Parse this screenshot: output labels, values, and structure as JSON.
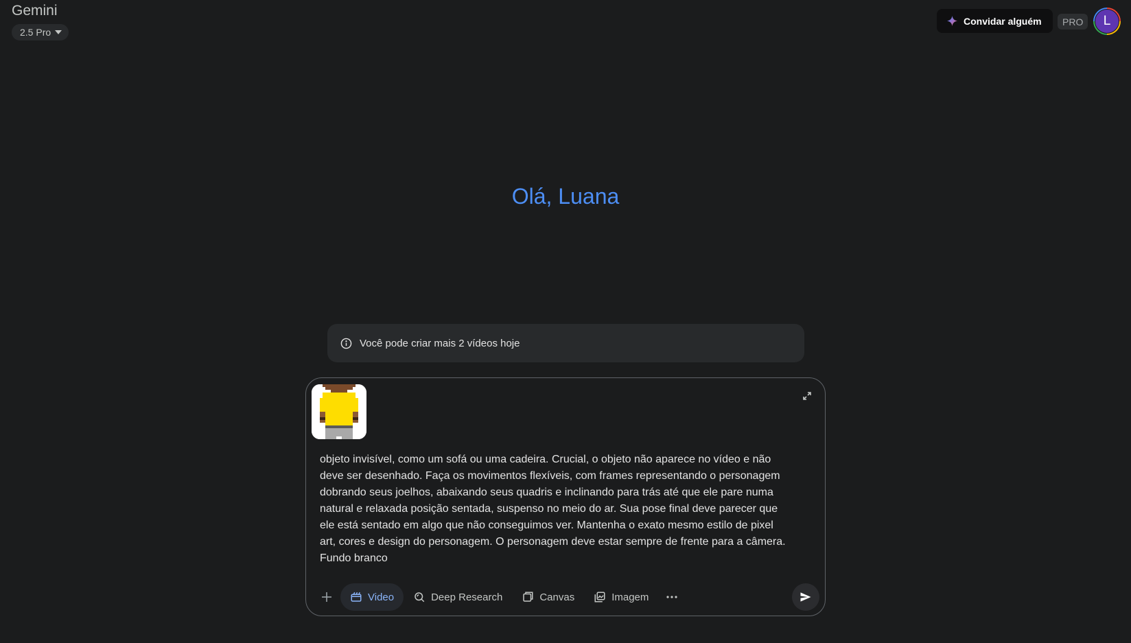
{
  "header": {
    "app_title": "Gemini",
    "model_label": "2.5 Pro",
    "invite_label": "Convidar alguém",
    "pro_badge": "PRO",
    "avatar_initial": "L"
  },
  "greeting": "Olá, Luana",
  "notice": {
    "icon": "info-icon",
    "text": "Você pode criar mais 2 vídeos hoje"
  },
  "composer": {
    "prompt_text": "objeto invisível, como um sofá ou uma cadeira. Crucial, o objeto não aparece no vídeo e não\ndeve ser desenhado. Faça os movimentos flexíveis, com frames representando o personagem\ndobrando seus joelhos, abaixando seus quadris e inclinando para trás até que ele pare numa\nnatural e relaxada posição sentada, suspenso no meio do ar. Sua pose final deve parecer que\nele está sentado em algo que não conseguimos ver. Mantenha o exato mesmo estilo de pixel\nart, cores e design do personagem. O personagem deve estar sempre de frente para a câmera.\nFundo branco",
    "tools": [
      {
        "label": "Video",
        "icon": "video-icon",
        "active": true
      },
      {
        "label": "Deep Research",
        "icon": "deep-research-icon",
        "active": false
      },
      {
        "label": "Canvas",
        "icon": "canvas-icon",
        "active": false
      },
      {
        "label": "Imagem",
        "icon": "image-icon",
        "active": false
      }
    ]
  },
  "colors": {
    "background": "#1b1c1d",
    "greeting": "#4d8ef4",
    "active_tool": "#8ab4f8",
    "avatar": "#5e35b1"
  }
}
